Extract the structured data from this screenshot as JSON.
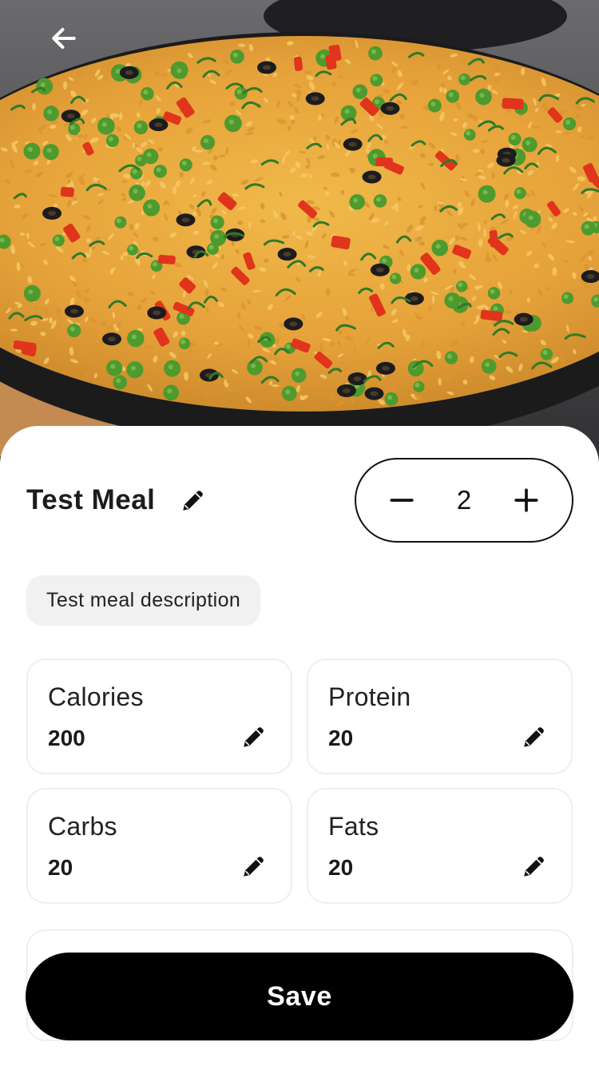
{
  "meal": {
    "title": "Test Meal",
    "description": "Test meal description"
  },
  "servings": {
    "value": "2"
  },
  "nutrition": [
    {
      "label": "Calories",
      "value": "200"
    },
    {
      "label": "Protein",
      "value": "20"
    },
    {
      "label": "Carbs",
      "value": "20"
    },
    {
      "label": "Fats",
      "value": "20"
    }
  ],
  "actions": {
    "save_label": "Save"
  },
  "icons": {
    "back": "arrow-left-icon",
    "edit": "pencil-icon",
    "decrement": "minus-icon",
    "increment": "plus-icon"
  },
  "colors": {
    "primary": "#000000",
    "chip_bg": "#f1f1f1",
    "card_border": "#efefef"
  }
}
